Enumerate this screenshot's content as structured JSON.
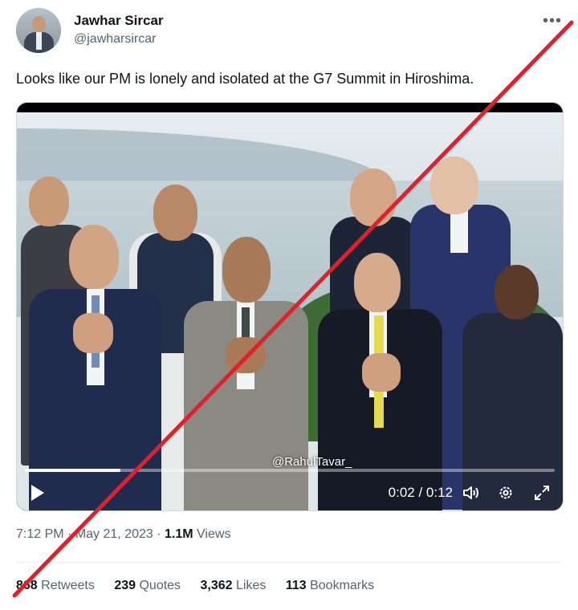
{
  "author": {
    "name": "Jawhar Sircar",
    "handle": "@jawharsircar"
  },
  "more_icon": "more-horizontal-icon",
  "tweet_text": "Looks like our PM is lonely and isolated at the G7 Summit in Hiroshima.",
  "video": {
    "watermark": "@RahulTavar_",
    "time": "0:02 / 0:12",
    "progress": 0.18,
    "icons": [
      "play-icon",
      "volume-icon",
      "settings-gear-icon",
      "fullscreen-icon"
    ]
  },
  "meta": {
    "time": "7:12 PM",
    "separator": "·",
    "date": "May 21, 2023",
    "views_count": "1.1M",
    "views_label": "Views"
  },
  "stats": {
    "retweets_count": "868",
    "retweets_label": "Retweets",
    "quotes_count": "239",
    "quotes_label": "Quotes",
    "likes_count": "3,362",
    "likes_label": "Likes",
    "bookmarks_count": "113",
    "bookmarks_label": "Bookmarks"
  },
  "overlay": {
    "strike_color": "#e0202a"
  }
}
